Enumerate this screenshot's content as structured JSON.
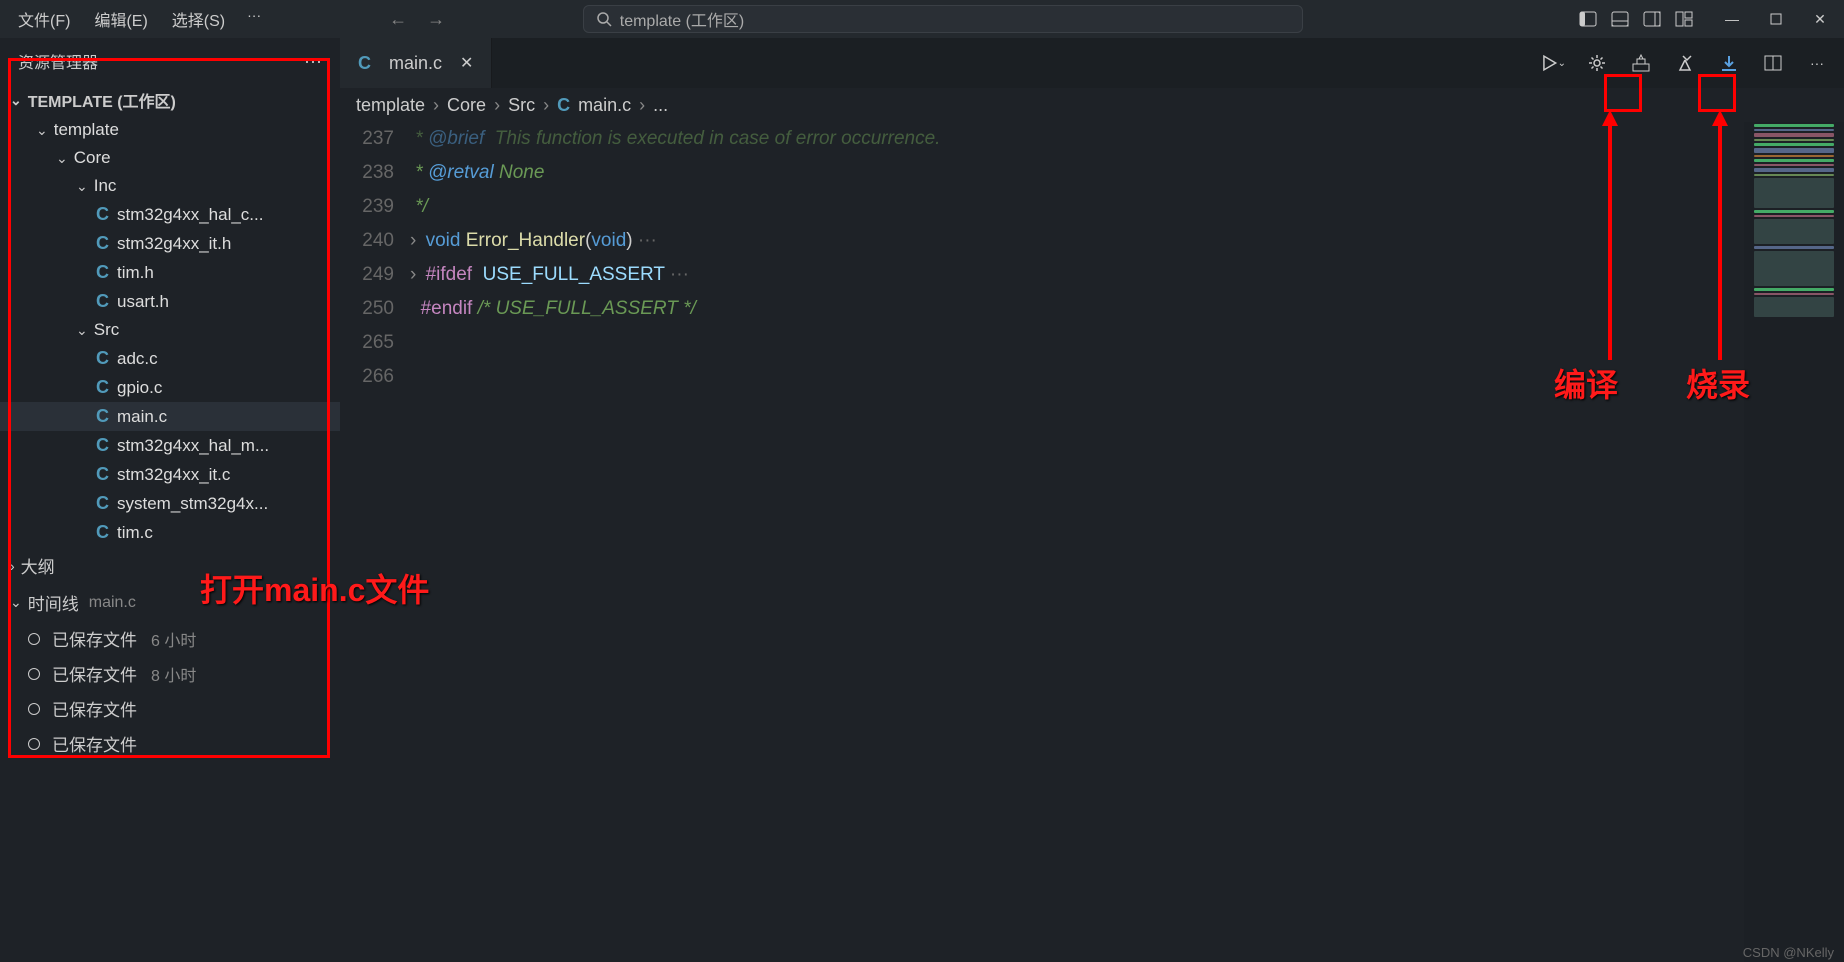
{
  "menu": {
    "file": "文件(F)",
    "edit": "编辑(E)",
    "select": "选择(S)"
  },
  "search": {
    "text": "template (工作区)"
  },
  "sidebar": {
    "title": "资源管理器",
    "root": "TEMPLATE (工作区)",
    "folders": {
      "template": "template",
      "core": "Core",
      "inc": "Inc",
      "src": "Src"
    },
    "inc_files": [
      "stm32g4xx_hal_c...",
      "stm32g4xx_it.h",
      "tim.h",
      "usart.h"
    ],
    "src_files": [
      "adc.c",
      "gpio.c",
      "main.c",
      "stm32g4xx_hal_m...",
      "stm32g4xx_it.c",
      "system_stm32g4x...",
      "tim.c"
    ],
    "src_selected": 2,
    "outline": "大纲",
    "timeline": {
      "label": "时间线",
      "file": "main.c"
    },
    "timeline_items": [
      {
        "label": "已保存文件",
        "time": "6 小时"
      },
      {
        "label": "已保存文件",
        "time": "8 小时"
      },
      {
        "label": "已保存文件",
        "time": ""
      },
      {
        "label": "已保存文件",
        "time": ""
      }
    ]
  },
  "tab": {
    "name": "main.c"
  },
  "breadcrumb": [
    "template",
    "Core",
    "Src",
    "main.c",
    "..."
  ],
  "code": {
    "lines": [
      {
        "n": "237",
        "html": " <span class='cm'>* <span class='doc'>@brief</span>  This function is executed in case of error occurrence.</span>",
        "cut": true
      },
      {
        "n": "238",
        "html": " <span class='cm'>* <span class='doc'>@retval</span> None</span>"
      },
      {
        "n": "239",
        "html": " <span class='cm'>*/</span>"
      },
      {
        "n": "240",
        "html": "<span class='fold'>›</span> <span class='type'>void</span> <span class='fn'>Error_Handler</span>(<span class='type'>void</span>)<span class='dim'> ···</span>"
      },
      {
        "n": "249",
        "html": ""
      },
      {
        "n": "250",
        "html": "<span class='fold'>›</span> <span class='preproc'>#ifdef</span>  <span class='macro'>USE_FULL_ASSERT</span><span class='dim'> ···</span>"
      },
      {
        "n": "265",
        "html": "  <span class='preproc'>#endif</span> <span class='cm'>/* USE_FULL_ASSERT */</span>"
      },
      {
        "n": "266",
        "html": ""
      }
    ]
  },
  "annotations": {
    "open_main": "打开main.c文件",
    "compile": "编译",
    "flash": "烧录"
  },
  "watermark": "CSDN @NKelly"
}
